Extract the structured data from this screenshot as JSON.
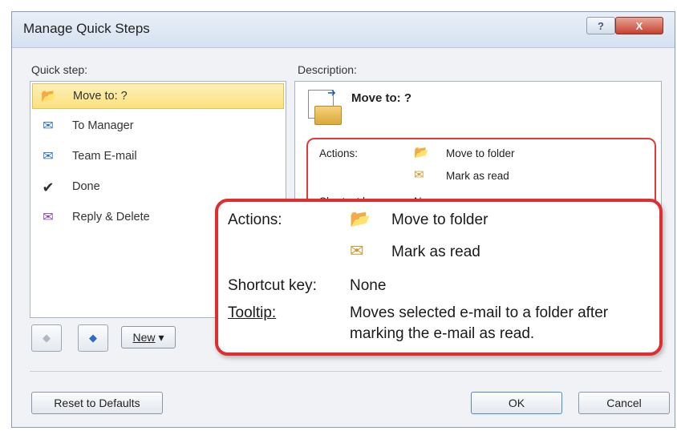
{
  "window": {
    "title": "Manage Quick Steps",
    "help_label": "?",
    "close_label": "X"
  },
  "quick_step_label": "Quick step:",
  "quick_steps": [
    {
      "label": "Move to: ?",
      "icon": "folder-move-icon",
      "selected": true
    },
    {
      "label": "To Manager",
      "icon": "forward-mail-icon",
      "selected": false
    },
    {
      "label": "Team E-mail",
      "icon": "team-mail-icon",
      "selected": false
    },
    {
      "label": "Done",
      "icon": "checkmark-icon",
      "selected": false
    },
    {
      "label": "Reply & Delete",
      "icon": "reply-delete-icon",
      "selected": false
    }
  ],
  "description_label": "Description:",
  "description": {
    "title": "Move to: ?",
    "actions_label": "Actions:",
    "actions": [
      {
        "label": "Move to folder",
        "icon": "folder-move-icon"
      },
      {
        "label": "Mark as read",
        "icon": "envelope-open-icon"
      }
    ],
    "shortcut_label": "Shortcut key:",
    "shortcut_value": "None"
  },
  "callout": {
    "actions_label": "Actions:",
    "actions": [
      {
        "label": "Move to folder",
        "icon": "folder-move-icon"
      },
      {
        "label": "Mark as read",
        "icon": "envelope-open-icon"
      }
    ],
    "shortcut_label": "Shortcut key:",
    "shortcut_value": "None",
    "tooltip_label": "Tooltip:",
    "tooltip_line1": "Moves selected e-mail to a folder after",
    "tooltip_line2": "marking the e-mail as read."
  },
  "buttons": {
    "new_label": "New",
    "new_arrow": "▾",
    "reset_label": "Reset to Defaults",
    "ok_label": "OK",
    "cancel_label": "Cancel"
  },
  "colors": {
    "accent_red": "#dd2f2f",
    "selection": "#fbe17c"
  }
}
